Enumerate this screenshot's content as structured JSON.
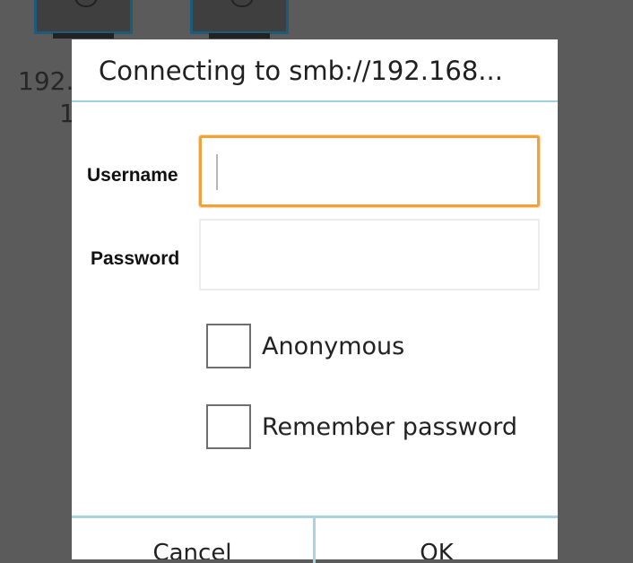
{
  "background": {
    "device_label_line1": "192.",
    "device_label_line2": "1"
  },
  "dialog": {
    "title": "Connecting to smb://192.168...",
    "username_label": "Username",
    "username_value": "",
    "password_label": "Password",
    "password_value": "",
    "anonymous_label": "Anonymous",
    "remember_label": "Remember password",
    "anonymous_checked": false,
    "remember_checked": false,
    "left_button_label": "Cancel",
    "right_button_label": "OK"
  },
  "colors": {
    "focus_border": "#f1a13a",
    "divider": "#a8d3e1",
    "scrim": "#5b5b5b"
  }
}
